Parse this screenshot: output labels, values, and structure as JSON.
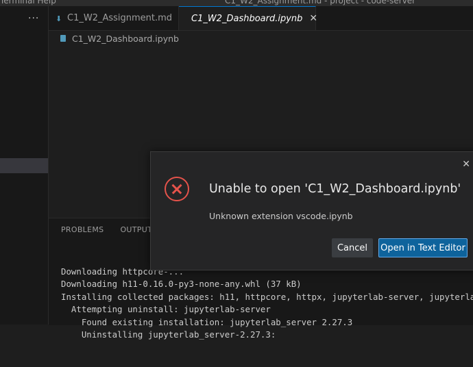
{
  "titlebar": {
    "left_menu": "Terminal   Help",
    "title": "C1_W2_Assignment.md - project - code-server"
  },
  "sidebar": {
    "more": "···"
  },
  "tabs": [
    {
      "label": "C1_W2_Assignment.md",
      "active": false
    },
    {
      "label": "C1_W2_Dashboard.ipynb",
      "active": true
    }
  ],
  "breadcrumb": {
    "label": "C1_W2_Dashboard.ipynb"
  },
  "panel": {
    "tabs": [
      "PROBLEMS",
      "OUTPUT"
    ],
    "terminal_lines": [
      "Downloading httpcore-...",
      "Downloading h11-0.16.0-py3-none-any.whl (37 kB)",
      "Installing collected packages: h11, httpcore, httpx, jupyterlab-server, jupyterla",
      "  Attempting uninstall: jupyterlab-server",
      "    Found existing installation: jupyterlab_server 2.27.3",
      "    Uninstalling jupyterlab_server-2.27.3:"
    ]
  },
  "dialog": {
    "title": "Unable to open 'C1_W2_Dashboard.ipynb'",
    "detail": "Unknown extension vscode.ipynb",
    "cancel_label": "Cancel",
    "primary_label": "Open in Text Editor",
    "close_glyph": "✕"
  },
  "colors": {
    "accent": "#0e639c",
    "error": "#e5534b",
    "file_icon": "#519aba"
  }
}
